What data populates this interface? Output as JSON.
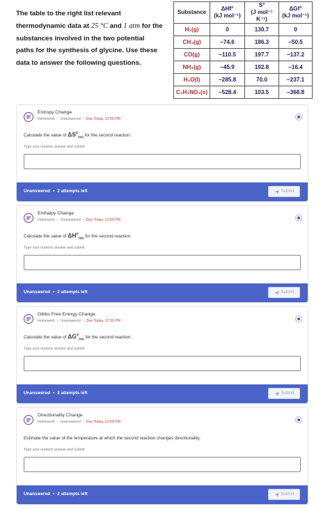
{
  "intro": {
    "part1": "The table to the right list relevant thermodynamic data at ",
    "temp": "25 °C",
    "part2": " and ",
    "pressure": "1 atm",
    "part3": " for the substances involved in the two potential paths for the synthesis of glycine. Use these data to answer the following questions."
  },
  "table": {
    "headers": [
      {
        "top": "Substance",
        "bottom": ""
      },
      {
        "top": "ΔHf°",
        "bottom": "(kJ mol⁻¹)"
      },
      {
        "top": "S°",
        "bottom": "(J mol⁻¹ K⁻¹)"
      },
      {
        "top": "ΔGf°",
        "bottom": "(kJ mol⁻¹)"
      }
    ],
    "rows": [
      {
        "substance": "H₂(g)",
        "dH": "0",
        "S": "130.7",
        "dG": "0"
      },
      {
        "substance": "CH₄(g)",
        "dH": "−74.6",
        "S": "186.3",
        "dG": "−50.5"
      },
      {
        "substance": "CO(g)",
        "dH": "−110.5",
        "S": "197.7",
        "dG": "−137.2"
      },
      {
        "substance": "NH₃(g)",
        "dH": "−45.9",
        "S": "192.8",
        "dG": "−16.4"
      },
      {
        "substance": "H₂O(l)",
        "dH": "−285.8",
        "S": "70.0",
        "dG": "−237.1"
      },
      {
        "substance": "C₂H₅NO₂(s)",
        "dH": "−528.4",
        "S": "103.5",
        "dG": "−368.8"
      }
    ]
  },
  "questions": [
    {
      "title": "Entropy Change",
      "type": "Homework",
      "state": "Unanswered",
      "due": "Due Today, 12:59 PM",
      "prompt_before": "Calculate the value of ",
      "symbol": "ΔS",
      "symbol_sup": "o",
      "symbol_sub": "rxn",
      "prompt_after": " for the second reaction.",
      "hint": "Type your numeric answer and submit",
      "status": "Unanswered",
      "attempts": "2 attempts left",
      "submit": "Submit"
    },
    {
      "title": "Enthalpy Change",
      "type": "Homework",
      "state": "Unanswered",
      "due": "Due Today, 12:59 PM",
      "prompt_before": "Calculate the value of ",
      "symbol": "ΔH",
      "symbol_sup": "o",
      "symbol_sub": "rxn",
      "prompt_after": " for the second reaction.",
      "hint": "Type your numeric answer and submit",
      "status": "Unanswered",
      "attempts": "2 attempts left",
      "submit": "Submit"
    },
    {
      "title": "Gibbs Free Energy Change",
      "type": "Homework",
      "state": "Unanswered",
      "due": "Due Today, 12:59 PM",
      "prompt_before": "Calculate the value of ",
      "symbol": "ΔG",
      "symbol_sup": "o",
      "symbol_sub": "rxn",
      "prompt_after": " for the second reaction.",
      "hint": "Type your numeric answer and submit",
      "status": "Unanswered",
      "attempts": "2 attempts left",
      "submit": "Submit"
    },
    {
      "title": "Directionality Change",
      "type": "Homework",
      "state": "Unanswered",
      "due": "Due Today, 12:59 PM",
      "prompt_before": "Estimate the value of the temperature at which the second reaction changes directionality.",
      "symbol": "",
      "symbol_sup": "",
      "symbol_sub": "",
      "prompt_after": "",
      "hint": "Type your numeric answer and submit",
      "status": "Unanswered",
      "attempts": "2 attempts left",
      "submit": "Submit"
    }
  ],
  "colors": {
    "accent": "#4a63c9",
    "due": "#c0392b",
    "substance": "#b3262a",
    "value": "#1a1a5a",
    "question_icon": "#6b3fa0"
  },
  "icons": {
    "question": "question-list-icon",
    "info": "info-dot-icon",
    "submit": "paper-plane-icon"
  }
}
